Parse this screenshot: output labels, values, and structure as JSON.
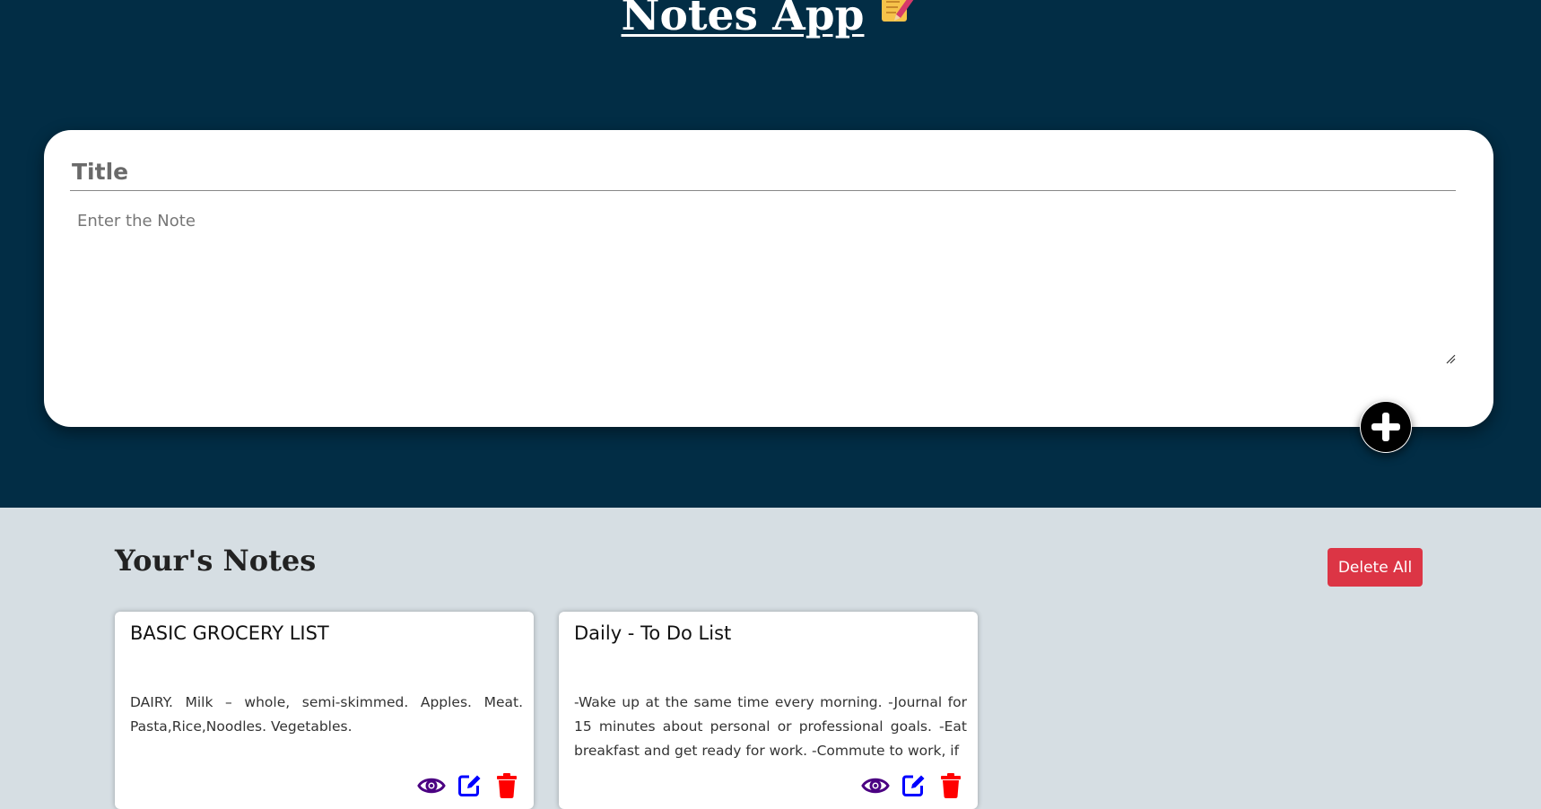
{
  "header": {
    "title": "Notes App"
  },
  "form": {
    "title_placeholder": "Title",
    "note_placeholder": "Enter the Note",
    "add_icon": "plus-circle-icon"
  },
  "notes_section": {
    "heading": "Your's Notes",
    "delete_all_label": "Delete All"
  },
  "notes": [
    {
      "title": "BASIC GROCERY LIST",
      "body": "DAIRY. Milk – whole, semi-skimmed. Apples. Meat. Pasta,Rice,Noodles. Vegetables."
    },
    {
      "title": "Daily - To Do List",
      "body": "-Wake up at the same time every morning. -Journal for 15 minutes about personal or professional goals. -Eat breakfast and get ready for work. -Commute to work, if"
    }
  ],
  "icons": {
    "view": "eye-icon",
    "edit": "edit-icon",
    "delete": "trash-icon",
    "title_emoji": "memo-icon"
  },
  "colors": {
    "header_bg": "#022d45",
    "page_bg": "#d6dee3",
    "delete_all": "#dc3545",
    "view_icon": "#4b0082",
    "edit_icon": "#0000ff",
    "delete_icon": "#ff0000"
  }
}
